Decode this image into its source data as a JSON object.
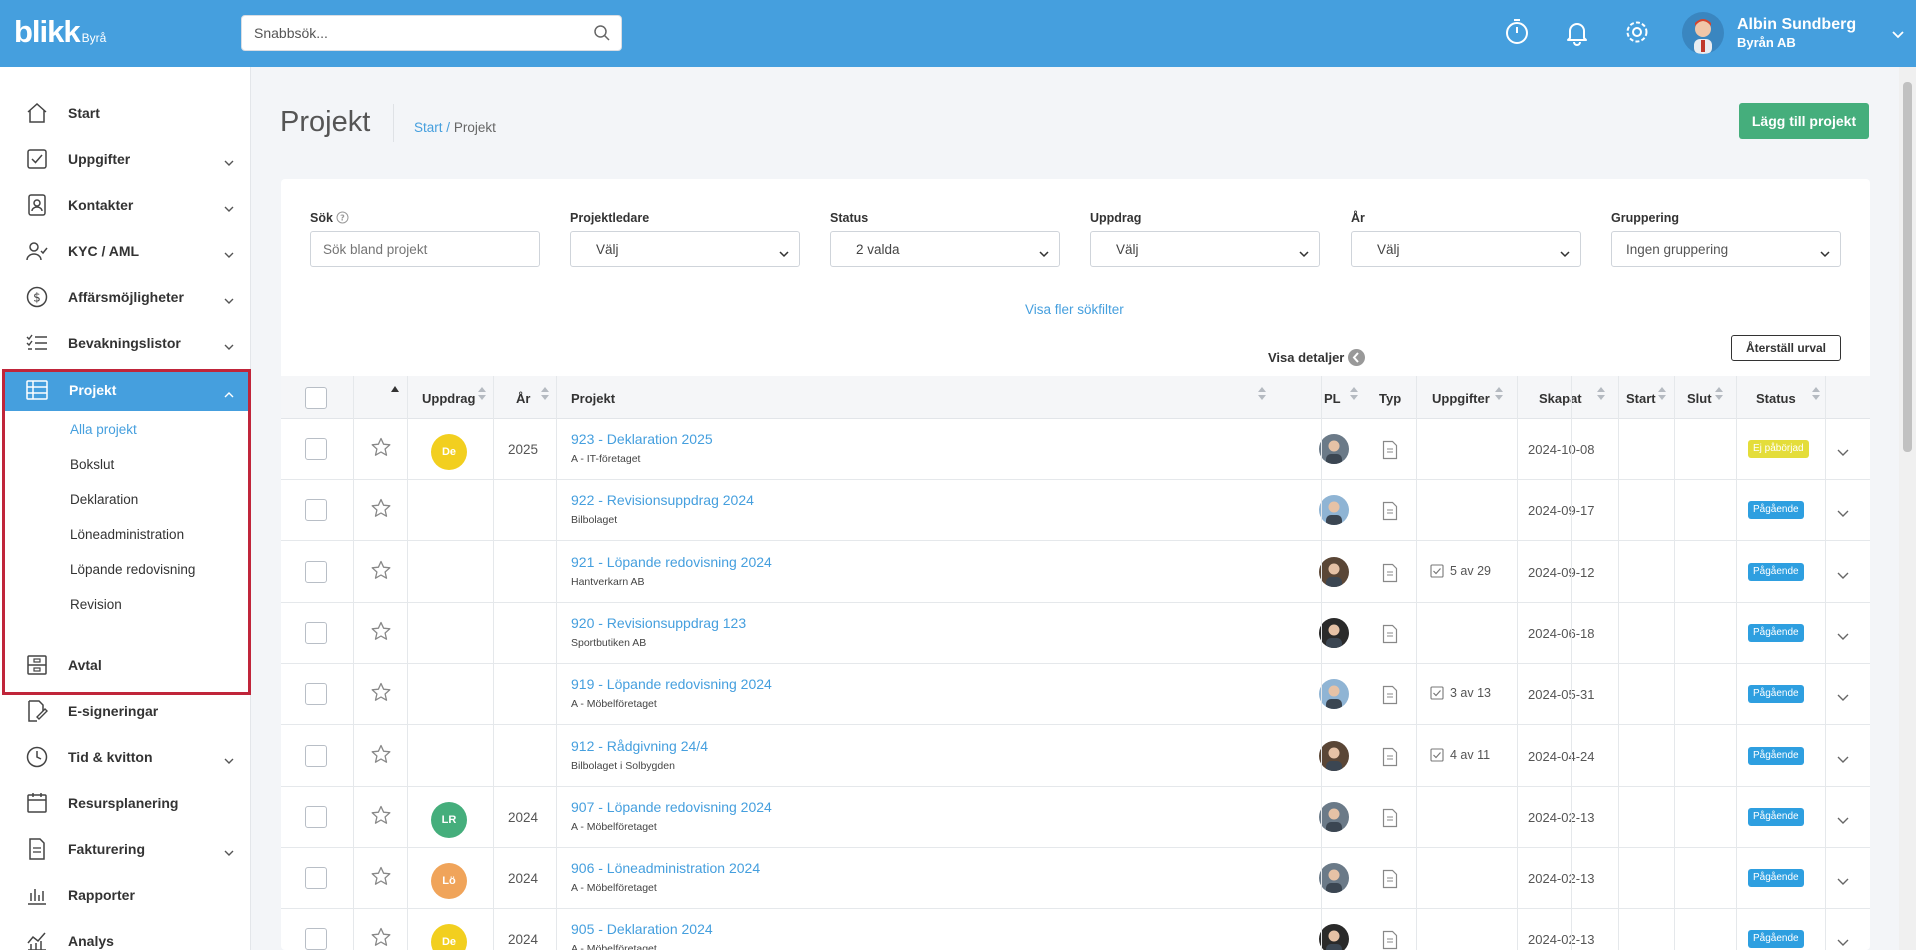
{
  "topbar": {
    "logo_main": "blikk",
    "logo_sub": "Byrå",
    "search_placeholder": "Snabbsök...",
    "user_name": "Albin Sundberg",
    "user_company": "Byrån AB",
    "icons": [
      "stopwatch-icon",
      "bell-icon",
      "gear-icon",
      "chevron-down-icon"
    ]
  },
  "sidebar": {
    "items": [
      {
        "label": "Start",
        "icon": "home-icon",
        "chevron": false
      },
      {
        "label": "Uppgifter",
        "icon": "checkbox-icon",
        "chevron": true
      },
      {
        "label": "Kontakter",
        "icon": "contact-icon",
        "chevron": true
      },
      {
        "label": "KYC / AML",
        "icon": "user-check-icon",
        "chevron": true
      },
      {
        "label": "Affärsmöjligheter",
        "icon": "dollar-icon",
        "chevron": true
      },
      {
        "label": "Bevakningslistor",
        "icon": "list-icon",
        "chevron": true
      },
      {
        "label": "Projekt",
        "icon": "table-icon",
        "chevron": true,
        "active": true
      },
      {
        "label": "Avtal",
        "icon": "archive-icon",
        "chevron": false
      },
      {
        "label": "E-signeringar",
        "icon": "signature-icon",
        "chevron": false
      },
      {
        "label": "Tid & kvitton",
        "icon": "clock-icon",
        "chevron": true
      },
      {
        "label": "Resursplanering",
        "icon": "calendar-icon",
        "chevron": false
      },
      {
        "label": "Fakturering",
        "icon": "document-icon",
        "chevron": true
      },
      {
        "label": "Rapporter",
        "icon": "bar-chart-icon",
        "chevron": false
      },
      {
        "label": "Analys",
        "icon": "analytics-icon",
        "chevron": false
      }
    ],
    "project_subitems": [
      {
        "label": "Alla projekt",
        "active": true
      },
      {
        "label": "Bokslut"
      },
      {
        "label": "Deklaration"
      },
      {
        "label": "Löneadministration"
      },
      {
        "label": "Löpande redovisning"
      },
      {
        "label": "Revision"
      }
    ]
  },
  "main": {
    "title": "Projekt",
    "breadcrumb_start": "Start",
    "breadcrumb_sep": "/",
    "breadcrumb_current": "Projekt",
    "add_button": "Lägg till projekt"
  },
  "filters": {
    "search_label": "Sök",
    "search_placeholder": "Sök bland projekt",
    "fields": [
      {
        "label": "Projektledare",
        "value": "Välj"
      },
      {
        "label": "Status",
        "value": "2 valda"
      },
      {
        "label": "Uppdrag",
        "value": "Välj"
      },
      {
        "label": "År",
        "value": "Välj"
      },
      {
        "label": "Gruppering",
        "value": "Ingen gruppering"
      }
    ],
    "more_filters": "Visa fler sökfilter",
    "reset": "Återställ urval",
    "details": "Visa detaljer"
  },
  "table": {
    "columns": {
      "uppdrag": "Uppdrag",
      "ar": "År",
      "projekt": "Projekt",
      "pl": "PL",
      "typ": "Typ",
      "uppgifter": "Uppgifter",
      "skapat": "Skapat",
      "start": "Start",
      "slut": "Slut",
      "status": "Status"
    },
    "rows": [
      {
        "badge": "De",
        "badge_color": "#f2cf1f",
        "year": "2025",
        "title": "923 - Deklaration 2025",
        "client": "A - IT-företaget",
        "avatar": "#6b7a88",
        "tasks": "",
        "created": "2024-10-08",
        "status": "Ej påbörjad",
        "status_color": "#e4dd3a"
      },
      {
        "badge": "",
        "badge_color": "",
        "year": "",
        "title": "922 - Revisionsuppdrag 2024",
        "client": "Bilbolaget",
        "avatar": "#8fb4d4",
        "tasks": "",
        "created": "2024-09-17",
        "status": "Pågående",
        "status_color": "#2e9fe0"
      },
      {
        "badge": "",
        "badge_color": "",
        "year": "",
        "title": "921 - Löpande redovisning 2024",
        "client": "Hantverkarn AB",
        "avatar": "#5a4636",
        "tasks": "5 av 29",
        "created": "2024-09-12",
        "status": "Pågående",
        "status_color": "#2e9fe0"
      },
      {
        "badge": "",
        "badge_color": "",
        "year": "",
        "title": "920 - Revisionsuppdrag 123",
        "client": "Sportbutiken AB",
        "avatar": "#2a2a2a",
        "tasks": "",
        "created": "2024-06-18",
        "status": "Pågående",
        "status_color": "#2e9fe0"
      },
      {
        "badge": "",
        "badge_color": "",
        "year": "",
        "title": "919 - Löpande redovisning 2024",
        "client": "A - Möbelföretaget",
        "avatar": "#8fb4d4",
        "tasks": "3 av 13",
        "created": "2024-05-31",
        "status": "Pågående",
        "status_color": "#2e9fe0"
      },
      {
        "badge": "",
        "badge_color": "",
        "year": "",
        "title": "912 - Rådgivning 24/4",
        "client": "Bilbolaget i Solbygden",
        "avatar": "#5a4636",
        "tasks": "4 av 11",
        "created": "2024-04-24",
        "status": "Pågående",
        "status_color": "#2e9fe0"
      },
      {
        "badge": "LR",
        "badge_color": "#45ae7c",
        "year": "2024",
        "title": "907 - Löpande redovisning 2024",
        "client": "A - Möbelföretaget",
        "avatar": "#6b7a88",
        "tasks": "",
        "created": "2024-02-13",
        "status": "Pågående",
        "status_color": "#2e9fe0"
      },
      {
        "badge": "Lö",
        "badge_color": "#f0a45a",
        "year": "2024",
        "title": "906 - Löneadministration 2024",
        "client": "A - Möbelföretaget",
        "avatar": "#6b7a88",
        "tasks": "",
        "created": "2024-02-13",
        "status": "Pågående",
        "status_color": "#2e9fe0"
      },
      {
        "badge": "De",
        "badge_color": "#f2cf1f",
        "year": "2024",
        "title": "905 - Deklaration 2024",
        "client": "A - Möbelföretaget",
        "avatar": "#2a2a2a",
        "tasks": "",
        "created": "2024-02-13",
        "status": "Pågående",
        "status_color": "#2e9fe0"
      }
    ]
  },
  "colors": {
    "brand": "#459fde",
    "add_button": "#45ae7c",
    "active_frame": "#c0253a"
  }
}
